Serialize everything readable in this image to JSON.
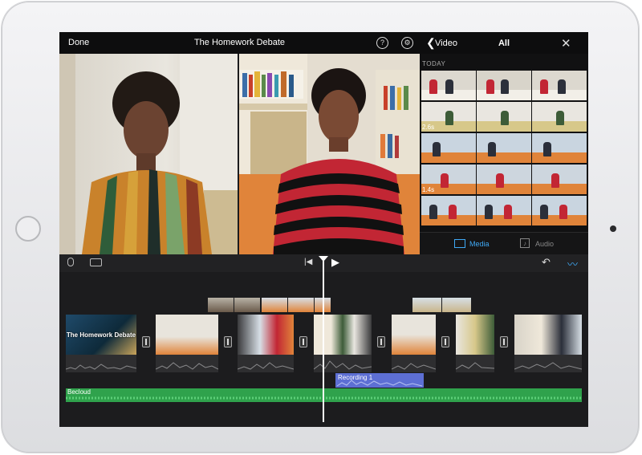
{
  "topbar": {
    "done_label": "Done",
    "project_title": "The Homework Debate",
    "help_icon": "help-icon",
    "settings_icon": "gear-icon"
  },
  "media_browser": {
    "back_label": "Video",
    "filter_label": "All",
    "section_label": "TODAY",
    "durations": [
      "2.6s",
      "1.4s"
    ],
    "tabs": [
      {
        "label": "Media",
        "active": true
      },
      {
        "label": "Audio",
        "active": false
      }
    ]
  },
  "timeline": {
    "title_clip_text": "The Homework Debate",
    "recording_label": "Recording 1",
    "music_label": "Becloud"
  },
  "colors": {
    "accent": "#3fa9f5",
    "music_track": "#2fa24c",
    "recording_track": "#5d6fd4",
    "background": "#1b1b1d"
  }
}
